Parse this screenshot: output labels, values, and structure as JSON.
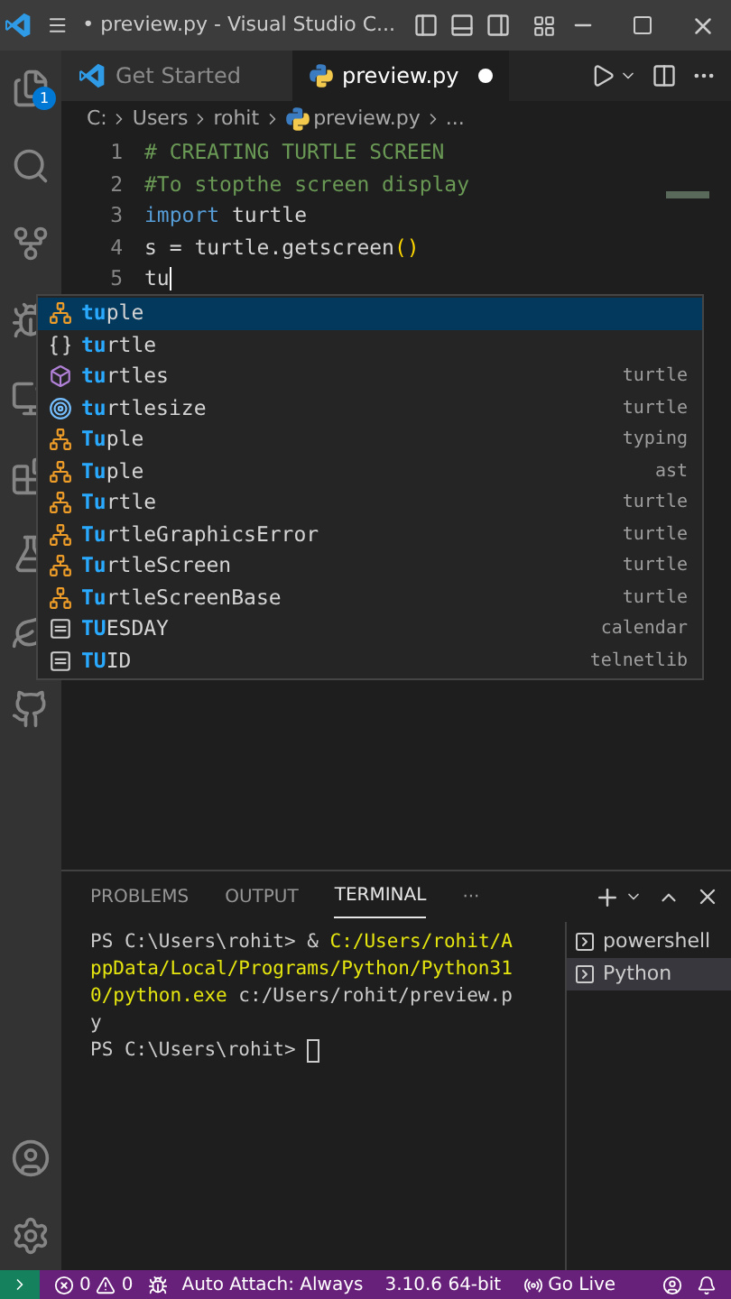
{
  "title_bar": {
    "title": "• preview.py - Visual Studio C..."
  },
  "activity_bar": {
    "explorer_badge": "1"
  },
  "tabs": [
    {
      "label": "Get Started",
      "kind": "welcome",
      "selected": false,
      "modified": false
    },
    {
      "label": "preview.py",
      "kind": "python",
      "selected": true,
      "modified": true
    }
  ],
  "breadcrumb": [
    "C:",
    "Users",
    "rohit",
    "preview.py",
    "..."
  ],
  "code_lines": [
    {
      "number": "1",
      "tokens": [
        {
          "kind": "comment",
          "text": "# CREATING TURTLE SCREEN"
        }
      ]
    },
    {
      "number": "2",
      "tokens": [
        {
          "kind": "comment",
          "text": "#To stopthe screen display"
        }
      ]
    },
    {
      "number": "3",
      "tokens": [
        {
          "kind": "keyword",
          "text": "import"
        },
        {
          "kind": "plain",
          "text": " turtle"
        }
      ]
    },
    {
      "number": "4",
      "tokens": [
        {
          "kind": "plain",
          "text": "s = turtle.getscreen"
        },
        {
          "kind": "paren",
          "text": "()"
        }
      ]
    },
    {
      "number": "5",
      "tokens": [
        {
          "kind": "plain",
          "text": "tu"
        }
      ]
    }
  ],
  "suggestions": [
    {
      "kind": "class",
      "match": "tu",
      "rest": "ple",
      "selected": true
    },
    {
      "kind": "module",
      "match": "tu",
      "rest": "rtle",
      "selected": false
    },
    {
      "kind": "function",
      "match": "tu",
      "rest": "rtles",
      "source": "turtle",
      "selected": false
    },
    {
      "kind": "variable",
      "match": "tu",
      "rest": "rtlesize",
      "source": "turtle",
      "selected": false
    },
    {
      "kind": "class",
      "match": "Tu",
      "rest": "ple",
      "source": "typing",
      "selected": false
    },
    {
      "kind": "class",
      "match": "Tu",
      "rest": "ple",
      "source": "ast",
      "selected": false
    },
    {
      "kind": "class",
      "match": "Tu",
      "rest": "rtle",
      "source": "turtle",
      "selected": false
    },
    {
      "kind": "class",
      "match": "Tu",
      "rest": "rtleGraphicsError",
      "source": "turtle",
      "selected": false
    },
    {
      "kind": "class",
      "match": "Tu",
      "rest": "rtleScreen",
      "source": "turtle",
      "selected": false
    },
    {
      "kind": "class",
      "match": "Tu",
      "rest": "rtleScreenBase",
      "source": "turtle",
      "selected": false
    },
    {
      "kind": "constant",
      "match": "TU",
      "rest": "ESDAY",
      "source": "calendar",
      "selected": false
    },
    {
      "kind": "constant",
      "match": "TU",
      "rest": "ID",
      "source": "telnetlib",
      "selected": false
    }
  ],
  "panel": {
    "tabs": [
      {
        "label": "PROBLEMS",
        "selected": false
      },
      {
        "label": "OUTPUT",
        "selected": false
      },
      {
        "label": "TERMINAL",
        "selected": true
      },
      {
        "label": "···",
        "selected": false
      }
    ],
    "terminal_lines": [
      [
        {
          "kind": "plain",
          "text": "PS C:\\Users\\rohit> & "
        },
        {
          "kind": "path",
          "text": "C:/Users/rohit/A"
        }
      ],
      [
        {
          "kind": "path",
          "text": "ppData/Local/Programs/Python/Python31"
        }
      ],
      [
        {
          "kind": "path",
          "text": "0/python.exe"
        },
        {
          "kind": "plain",
          "text": " c:/Users/rohit/preview.p"
        }
      ],
      [
        {
          "kind": "plain",
          "text": "y"
        }
      ],
      [
        {
          "kind": "plain",
          "text": "PS C:\\Users\\rohit> "
        },
        {
          "kind": "cursor"
        }
      ]
    ],
    "terminals": [
      {
        "label": "powershell",
        "selected": false
      },
      {
        "label": "Python",
        "selected": true
      }
    ]
  },
  "status_bar": {
    "errors": "0",
    "warnings": "0",
    "auto_attach": "Auto Attach: Always",
    "python_version": "3.10.6 64-bit",
    "go_live": "Go Live"
  }
}
